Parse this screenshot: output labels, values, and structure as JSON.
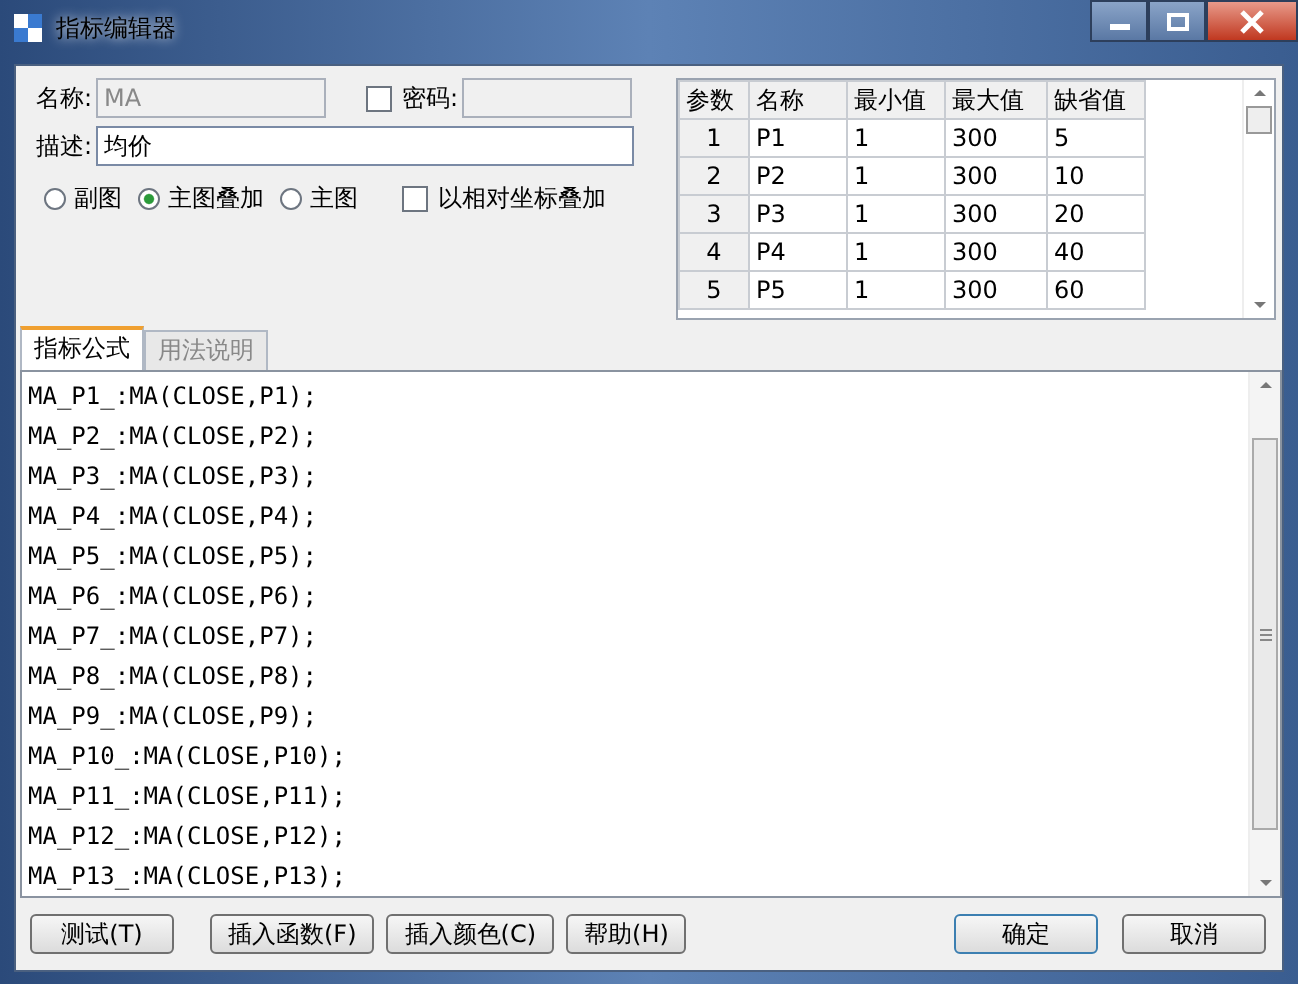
{
  "window": {
    "title": "指标编辑器"
  },
  "form": {
    "name_label": "名称:",
    "name_value": "MA",
    "password": {
      "label": "密码:",
      "checked": false
    },
    "desc_label": "描述:",
    "desc_value": "均价",
    "chart_modes": [
      {
        "label": "副图",
        "selected": false
      },
      {
        "label": "主图叠加",
        "selected": true
      },
      {
        "label": "主图",
        "selected": false
      }
    ],
    "relative": {
      "label": "以相对坐标叠加",
      "checked": false
    }
  },
  "params": {
    "columns": [
      "参数",
      "名称",
      "最小值",
      "最大值",
      "缺省值"
    ],
    "rows": [
      [
        "1",
        "P1",
        "1",
        "300",
        "5"
      ],
      [
        "2",
        "P2",
        "1",
        "300",
        "10"
      ],
      [
        "3",
        "P3",
        "1",
        "300",
        "20"
      ],
      [
        "4",
        "P4",
        "1",
        "300",
        "40"
      ],
      [
        "5",
        "P5",
        "1",
        "300",
        "60"
      ]
    ]
  },
  "tabs": [
    {
      "label": "指标公式",
      "selected": true
    },
    {
      "label": "用法说明",
      "selected": false
    }
  ],
  "formula": [
    "MA_P1_:MA(CLOSE,P1);",
    "MA_P2_:MA(CLOSE,P2);",
    "MA_P3_:MA(CLOSE,P3);",
    "MA_P4_:MA(CLOSE,P4);",
    "MA_P5_:MA(CLOSE,P5);",
    "MA_P6_:MA(CLOSE,P6);",
    "MA_P7_:MA(CLOSE,P7);",
    "MA_P8_:MA(CLOSE,P8);",
    "MA_P9_:MA(CLOSE,P9);",
    "MA_P10_:MA(CLOSE,P10);",
    "MA_P11_:MA(CLOSE,P11);",
    "MA_P12_:MA(CLOSE,P12);",
    "MA_P13_:MA(CLOSE,P13);"
  ],
  "buttons_left": [
    "测试(T)",
    "插入函数(F)",
    "插入颜色(C)",
    "帮助(H)"
  ],
  "buttons_right": [
    "确定",
    "取消"
  ]
}
